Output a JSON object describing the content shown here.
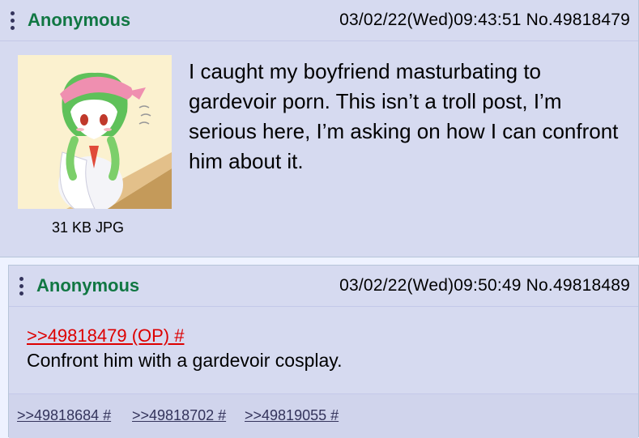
{
  "op": {
    "name": "Anonymous",
    "datetime": "03/02/22(Wed)09:43:51",
    "post_no": "No.49818479",
    "file_info": "31 KB JPG",
    "text": "I caught my boyfriend masturbating to gardevoir porn. This isn’t a troll post, I’m serious here, I’m asking on how I can confront him about it."
  },
  "reply": {
    "name": "Anonymous",
    "datetime": "03/02/22(Wed)09:50:49",
    "post_no": "No.49818489",
    "quote": ">>49818479 (OP) #",
    "text": "Confront him with a gardevoir cosplay.",
    "backlinks": [
      ">>49818684 #",
      ">>49818702 #",
      ">>49819055 #"
    ]
  },
  "colors": {
    "post_bg": "#d6daf0",
    "name": "#117743",
    "quote_link": "#dd0000",
    "backlink": "#34345c"
  },
  "icons": {
    "menu": "vertical-dots-icon",
    "thumbnail": "gardevoir-drawing"
  }
}
